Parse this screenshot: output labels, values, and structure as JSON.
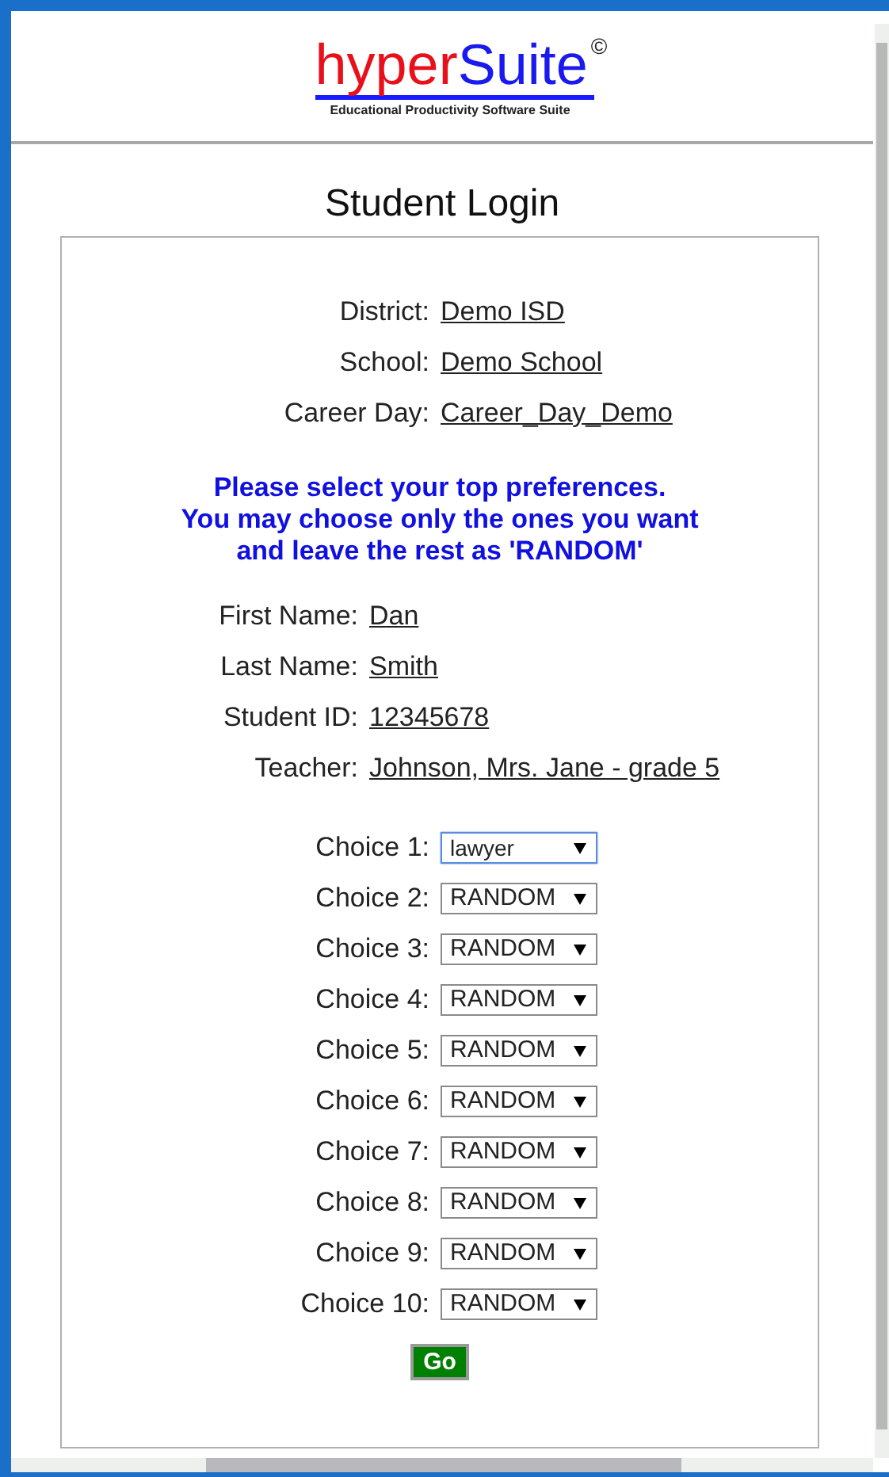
{
  "logo": {
    "brand_part_1": "hyper",
    "brand_part_2": "Suite",
    "mark": "©",
    "tagline": "Educational Productivity Software Suite"
  },
  "title": "Student Login",
  "context": [
    {
      "label": "District:",
      "value": "Demo ISD"
    },
    {
      "label": "School:",
      "value": "Demo School"
    },
    {
      "label": "Career Day:",
      "value": "Career_Day_Demo"
    }
  ],
  "instructions": [
    "Please select your top preferences.",
    "You may choose only the ones you want",
    "and leave the rest as 'RANDOM'"
  ],
  "student": [
    {
      "label": "First Name:",
      "value": "Dan"
    },
    {
      "label": "Last Name:",
      "value": "Smith"
    },
    {
      "label": "Student ID:",
      "value": "12345678"
    },
    {
      "label": "Teacher:",
      "value": "Johnson, Mrs. Jane - grade 5"
    }
  ],
  "choices": [
    {
      "label": "Choice 1:",
      "value": "lawyer",
      "focused": true
    },
    {
      "label": "Choice 2:",
      "value": "RANDOM",
      "focused": false
    },
    {
      "label": "Choice 3:",
      "value": "RANDOM",
      "focused": false
    },
    {
      "label": "Choice 4:",
      "value": "RANDOM",
      "focused": false
    },
    {
      "label": "Choice 5:",
      "value": "RANDOM",
      "focused": false
    },
    {
      "label": "Choice 6:",
      "value": "RANDOM",
      "focused": false
    },
    {
      "label": "Choice 7:",
      "value": "RANDOM",
      "focused": false
    },
    {
      "label": "Choice 8:",
      "value": "RANDOM",
      "focused": false
    },
    {
      "label": "Choice 9:",
      "value": "RANDOM",
      "focused": false
    },
    {
      "label": "Choice 10:",
      "value": "RANDOM",
      "focused": false
    }
  ],
  "submit": "Go"
}
